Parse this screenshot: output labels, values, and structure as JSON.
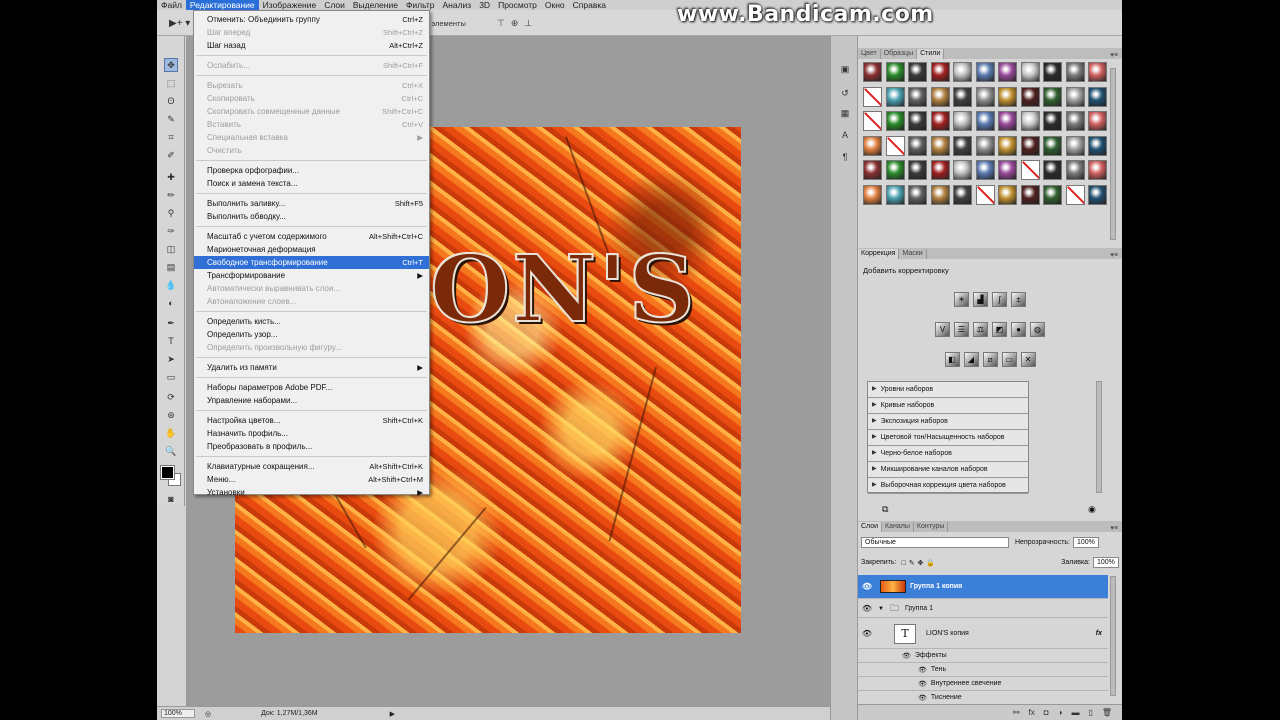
{
  "watermark": "www.Bandicam.com",
  "menubar": {
    "items": [
      "Файл",
      "Редактирование",
      "Изображение",
      "Слои",
      "Выделение",
      "Фильтр",
      "Анализ",
      "3D",
      "Просмотр",
      "Окно",
      "Справка"
    ],
    "active_index": 1
  },
  "options_bar": {
    "label": "ще элементы"
  },
  "edit_menu": {
    "groups": [
      [
        {
          "label": "Отменить: Объединить группу",
          "shortcut": "Ctrl+Z",
          "enabled": true
        },
        {
          "label": "Шаг вперед",
          "shortcut": "Shift+Ctrl+Z",
          "enabled": false
        },
        {
          "label": "Шаг назад",
          "shortcut": "Alt+Ctrl+Z",
          "enabled": true
        }
      ],
      [
        {
          "label": "Ослабить...",
          "shortcut": "Shift+Ctrl+F",
          "enabled": false
        }
      ],
      [
        {
          "label": "Вырезать",
          "shortcut": "Ctrl+X",
          "enabled": false
        },
        {
          "label": "Скопировать",
          "shortcut": "Ctrl+C",
          "enabled": false
        },
        {
          "label": "Скопировать совмещенные данные",
          "shortcut": "Shift+Ctrl+C",
          "enabled": false
        },
        {
          "label": "Вставить",
          "shortcut": "Ctrl+V",
          "enabled": false
        },
        {
          "label": "Специальная вставка",
          "shortcut": "",
          "enabled": false,
          "submenu": true
        },
        {
          "label": "Очистить",
          "shortcut": "",
          "enabled": false
        }
      ],
      [
        {
          "label": "Проверка орфографии...",
          "shortcut": "",
          "enabled": true
        },
        {
          "label": "Поиск и замена текста...",
          "shortcut": "",
          "enabled": true
        }
      ],
      [
        {
          "label": "Выполнить заливку...",
          "shortcut": "Shift+F5",
          "enabled": true
        },
        {
          "label": "Выполнить обводку...",
          "shortcut": "",
          "enabled": true
        }
      ],
      [
        {
          "label": "Масштаб с учетом содержимого",
          "shortcut": "Alt+Shift+Ctrl+C",
          "enabled": true
        },
        {
          "label": "Марионеточная деформация",
          "shortcut": "",
          "enabled": true
        },
        {
          "label": "Свободное трансформирование",
          "shortcut": "Ctrl+T",
          "enabled": true,
          "highlighted": true
        },
        {
          "label": "Трансформирование",
          "shortcut": "",
          "enabled": true,
          "submenu": true
        },
        {
          "label": "Автоматически выравнивать слои...",
          "shortcut": "",
          "enabled": false
        },
        {
          "label": "Автоналожение слоев...",
          "shortcut": "",
          "enabled": false
        }
      ],
      [
        {
          "label": "Определить кисть...",
          "shortcut": "",
          "enabled": true
        },
        {
          "label": "Определить узор...",
          "shortcut": "",
          "enabled": true
        },
        {
          "label": "Определить произвольную фигуру...",
          "shortcut": "",
          "enabled": false
        }
      ],
      [
        {
          "label": "Удалить из памяти",
          "shortcut": "",
          "enabled": true,
          "submenu": true
        }
      ],
      [
        {
          "label": "Наборы параметров Adobe PDF...",
          "shortcut": "",
          "enabled": true
        },
        {
          "label": "Управление наборами...",
          "shortcut": "",
          "enabled": true
        }
      ],
      [
        {
          "label": "Настройка цветов...",
          "shortcut": "Shift+Ctrl+K",
          "enabled": true
        },
        {
          "label": "Назначить профиль...",
          "shortcut": "",
          "enabled": true
        },
        {
          "label": "Преобразовать в профиль...",
          "shortcut": "",
          "enabled": true
        }
      ],
      [
        {
          "label": "Клавиатурные сокращения...",
          "shortcut": "Alt+Shift+Ctrl+K",
          "enabled": true
        },
        {
          "label": "Меню...",
          "shortcut": "Alt+Shift+Ctrl+M",
          "enabled": true
        },
        {
          "label": "Установки",
          "shortcut": "",
          "enabled": true,
          "submenu": true
        }
      ]
    ]
  },
  "canvas": {
    "text": "ON'S"
  },
  "statusbar": {
    "zoom": "100%",
    "doc": "Док: 1,27M/1,36M"
  },
  "styles_panel": {
    "tabs": [
      "Цвет",
      "Образцы",
      "Стили"
    ],
    "active_tab": 2
  },
  "adjust_panel": {
    "tabs": [
      "Коррекция",
      "Маски"
    ],
    "title": "Добавить корректировку",
    "presets": [
      "Уровни наборов",
      "Кривые наборов",
      "Экспозиция наборов",
      "Цветовой тон/Насыщенность наборов",
      "Черно-белое наборов",
      "Микширование каналов наборов",
      "Выборочная коррекция цвета наборов"
    ]
  },
  "layers_panel": {
    "tabs": [
      "Слои",
      "Каналы",
      "Контуры"
    ],
    "blend_mode": "Обычные",
    "opacity_label": "Непрозрачность:",
    "opacity_value": "100%",
    "lock_label": "Закрепить:",
    "fill_label": "Заливка:",
    "fill_value": "100%",
    "layers": [
      {
        "name": "Группа 1 копия",
        "selected": true
      },
      {
        "name": "Группа 1",
        "selected": false
      },
      {
        "name": "LION'S копия",
        "selected": false
      }
    ],
    "effects_label": "Эффекты",
    "effects": [
      "Тень",
      "Внутреннее свечение",
      "Тиснение"
    ]
  }
}
